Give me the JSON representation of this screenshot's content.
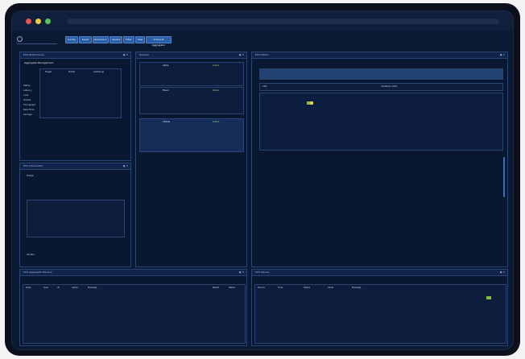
{
  "toolbar": {
    "buttons": [
      "Config",
      "Reset",
      "Resolution",
      "Update",
      "Filter",
      "Help",
      "W Result Aggregator"
    ]
  },
  "panels": {
    "left_top_title": "ECU Performance",
    "left_mid_title": "ECU Information",
    "center_title": "Devices",
    "right_title": "ECU Matrix",
    "bottom_left_title": "CFG Aggregate Window",
    "bottom_right_title": "CFG Device"
  },
  "left_top": {
    "name": "Aggregate Management",
    "headers": [
      "Target",
      "Profile",
      "Additional"
    ],
    "rows": [
      "Status",
      "Latency",
      "Load",
      "Output",
      "Throughput",
      "Peak Time",
      "Average"
    ]
  },
  "left_mid": {
    "label": "Bridge",
    "footer": "Parallel"
  },
  "center_devices": [
    {
      "name": "Alpha",
      "status": "Online"
    },
    {
      "name": "Bravo",
      "status": "Online"
    },
    {
      "name": "Charlie",
      "status": "Online"
    }
  ],
  "matrix": {
    "row_label": "ADS",
    "count": "Violations 1024"
  },
  "bottom_left": {
    "headers": [
      "Date",
      "Type",
      "ID",
      "Action",
      "Message",
      "Result",
      "Status"
    ]
  },
  "bottom_right": {
    "headers": [
      "Device",
      "Time",
      "Status",
      "Value",
      "Message"
    ]
  },
  "colors": {
    "background": "#0b1a33",
    "panel": "#0a1730",
    "accent": "#2a5ea6",
    "green": "#7fbf3a",
    "yellow": "#e8c94a"
  }
}
